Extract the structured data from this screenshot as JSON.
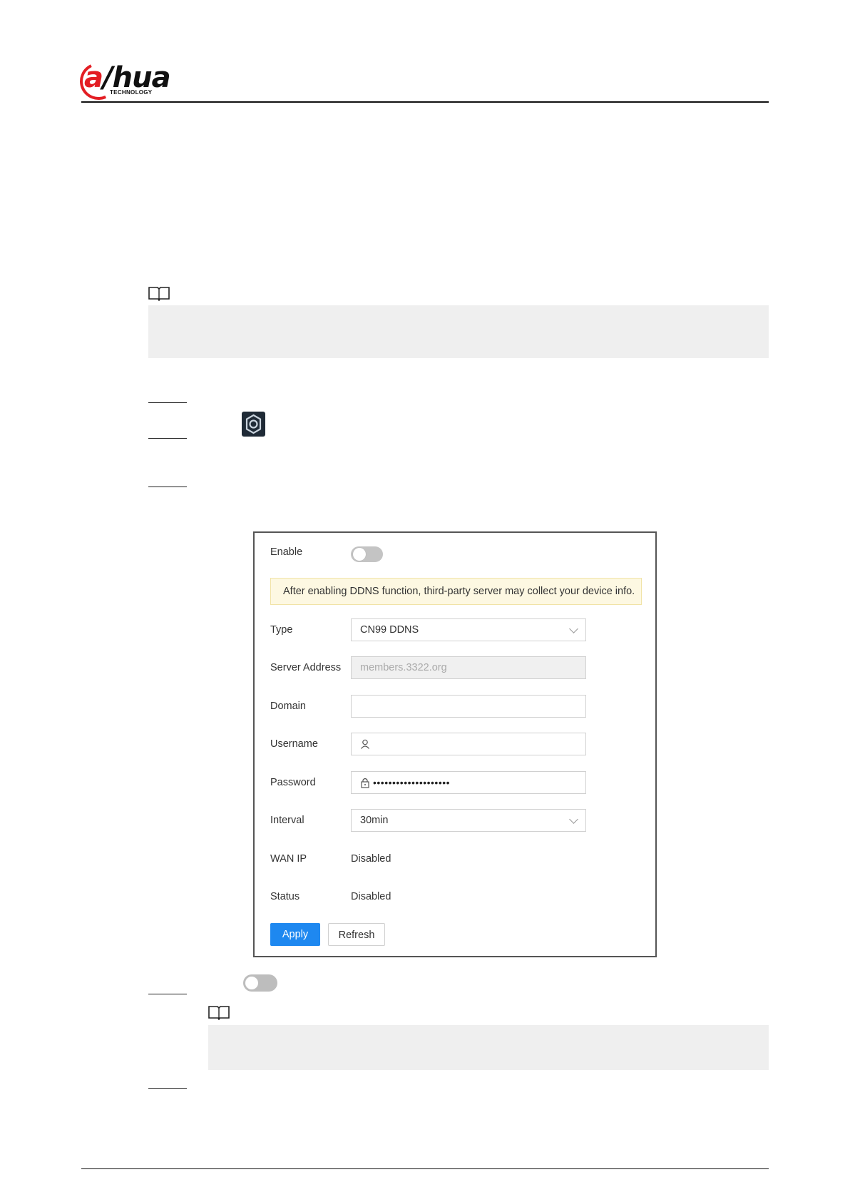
{
  "header": {
    "logo_text": "alhua",
    "logo_subtext": "TECHNOLOGY"
  },
  "icons": {
    "note": "book-icon",
    "settings": "gear-icon",
    "toggle": "toggle-off-icon",
    "user": "user-icon",
    "lock": "lock-icon",
    "dropdown": "chevron-down-icon"
  },
  "panel": {
    "enable_label": "Enable",
    "enable_state": "off",
    "banner_text": "After enabling DDNS function, third-party server may collect your device info.",
    "type_label": "Type",
    "type_value": "CN99 DDNS",
    "server_label": "Server Address",
    "server_value": "members.3322.org",
    "domain_label": "Domain",
    "domain_value": "",
    "username_label": "Username",
    "username_value": "",
    "password_label": "Password",
    "password_value": "••••••••••••••••••••",
    "interval_label": "Interval",
    "interval_value": "30min",
    "wanip_label": "WAN IP",
    "wanip_value": "Disabled",
    "status_label": "Status",
    "status_value": "Disabled",
    "apply_label": "Apply",
    "refresh_label": "Refresh"
  },
  "colors": {
    "brand_red": "#e31e24",
    "apply_blue": "#1e88f0",
    "banner_bg": "#fdf8e2",
    "note_bg": "#efefef"
  }
}
